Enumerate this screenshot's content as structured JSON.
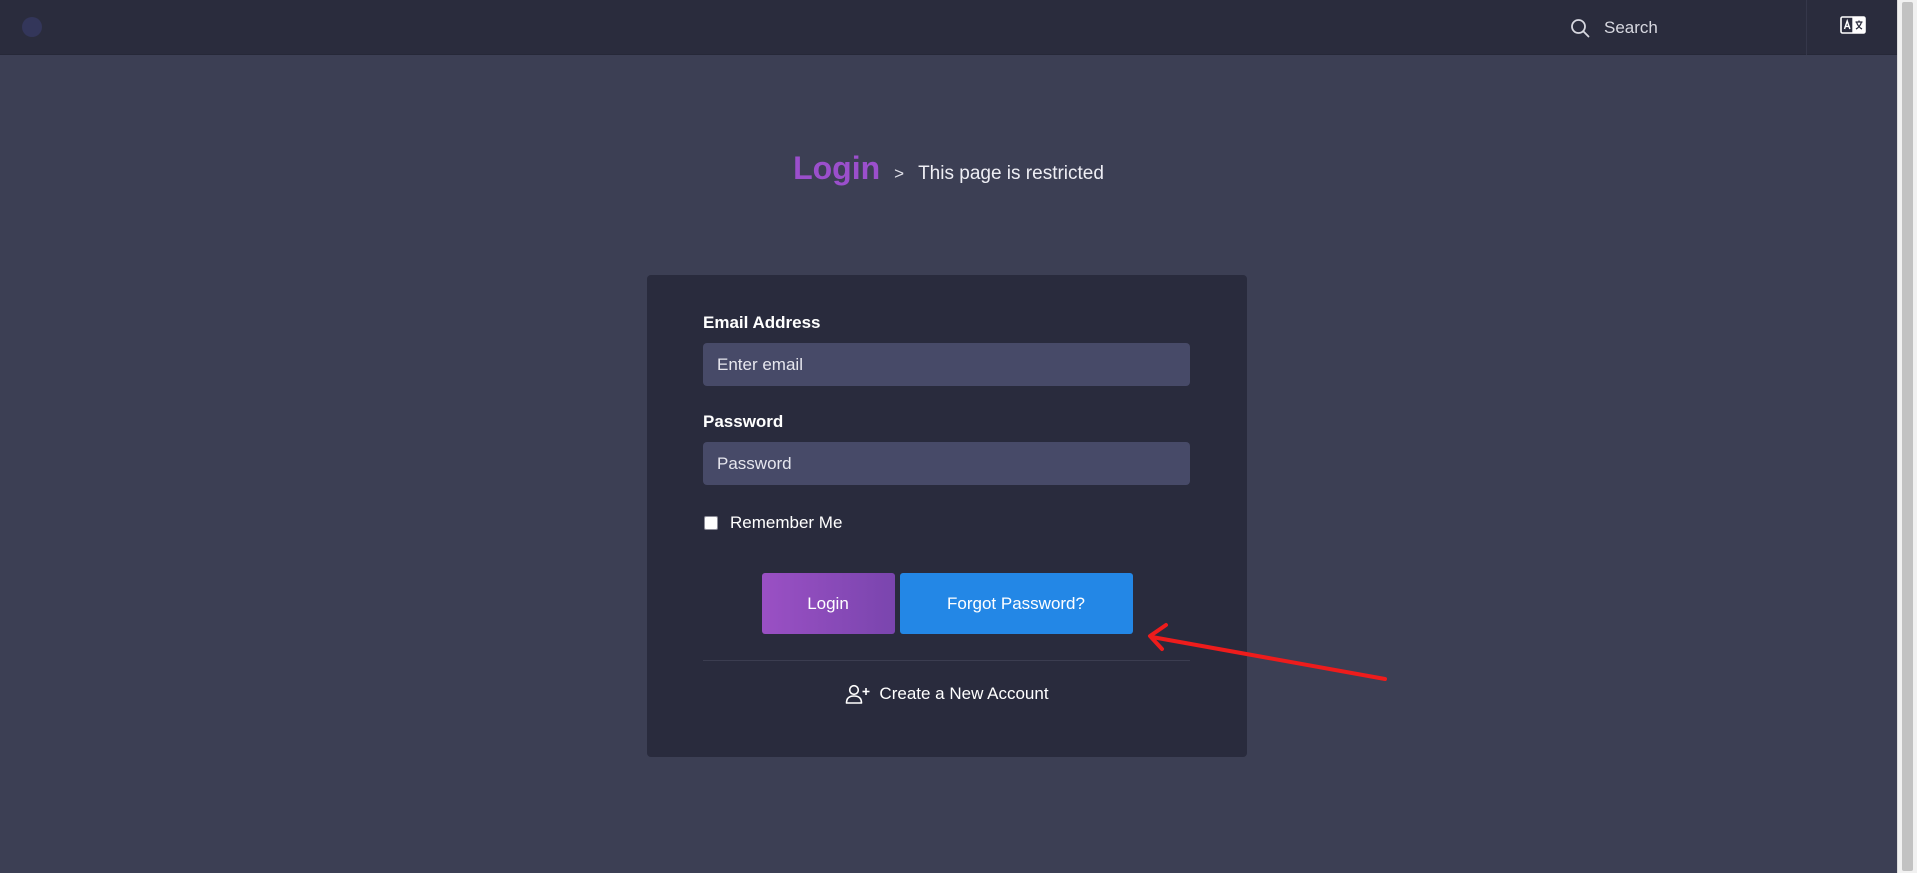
{
  "topbar": {
    "search_label": "Search"
  },
  "heading": {
    "title": "Login",
    "separator": ">",
    "subtitle": "This page is restricted"
  },
  "form": {
    "email_label": "Email Address",
    "email_placeholder": "Enter email",
    "password_label": "Password",
    "password_placeholder": "Password",
    "remember_label": "Remember Me",
    "remember_checked": false,
    "login_button": "Login",
    "forgot_button": "Forgot Password?",
    "create_account": "Create a New Account"
  },
  "colors": {
    "background": "#3c3f54",
    "card": "#292b3d",
    "title_accent": "#9b4fcc",
    "login_button": "#8a4bbb",
    "forgot_button": "#2387e6",
    "annotation": "#ee1c1c"
  },
  "icons": {
    "search": "search-icon",
    "translate": "translate-icon",
    "add_user": "add-user-icon"
  }
}
